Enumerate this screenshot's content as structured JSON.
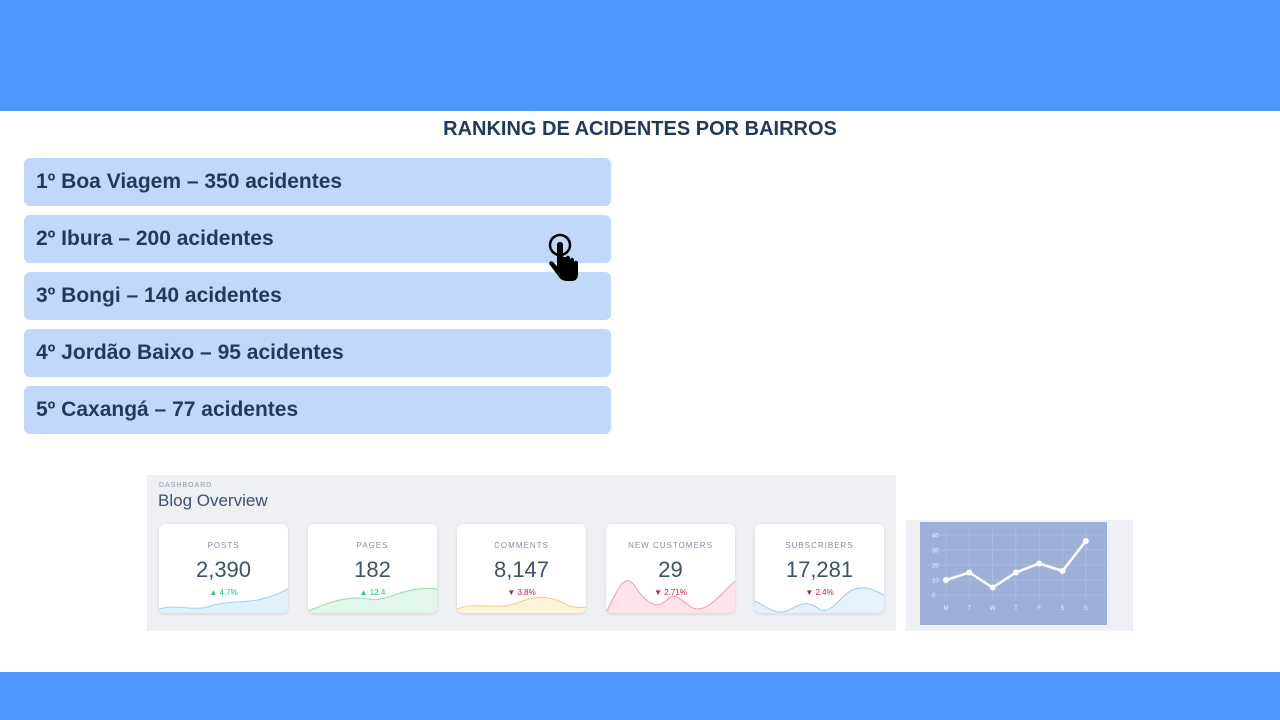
{
  "title": "RANKING DE ACIDENTES POR BAIRROS",
  "ranking": [
    {
      "label": "1º Boa Viagem – 350 acidentes",
      "count": 350
    },
    {
      "label": "2º Ibura – 200 acidentes",
      "count": 200
    },
    {
      "label": "3º Bongi – 140 acidentes",
      "count": 140
    },
    {
      "label": "4º Jordão Baixo – 95 acidentes",
      "count": 95
    },
    {
      "label": "5º Caxangá – 77 acidentes",
      "count": 77
    }
  ],
  "dashboard": {
    "kicker": "DASHBOARD",
    "title": "Blog Overview",
    "cards": [
      {
        "label": "POSTS",
        "value": "2,390",
        "delta": "4.7%",
        "trend": "up",
        "color": "#17c671"
      },
      {
        "label": "PAGES",
        "value": "182",
        "delta": "12.4",
        "trend": "up",
        "color": "#17c671"
      },
      {
        "label": "COMMENTS",
        "value": "8,147",
        "delta": "3.8%",
        "trend": "down",
        "color": "#c4183c"
      },
      {
        "label": "NEW CUSTOMERS",
        "value": "29",
        "delta": "2.71%",
        "trend": "down",
        "color": "#c4183c"
      },
      {
        "label": "SUBSCRIBERS",
        "value": "17,281",
        "delta": "2.4%",
        "trend": "down",
        "color": "#c4183c"
      }
    ]
  },
  "chart_data": {
    "type": "line",
    "categories": [
      "M",
      "T",
      "W",
      "T",
      "F",
      "S",
      "S"
    ],
    "values": [
      10,
      15,
      5,
      15,
      21,
      16,
      36
    ],
    "y_ticks": [
      0,
      10,
      20,
      30,
      40
    ],
    "ylim": [
      0,
      40
    ],
    "grid": true
  },
  "icons": {
    "cursor": "hand-pointer-icon"
  },
  "colors": {
    "band": "#5097ff",
    "item_bg": "#c0d9fb",
    "text": "#1f3a5f"
  }
}
